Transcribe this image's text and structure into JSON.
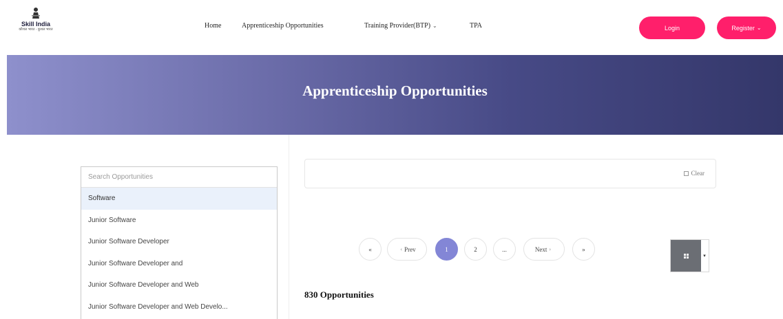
{
  "header": {
    "logo": {
      "text": "Skill India",
      "tagline": "कौशल भारत - कुशल भारत"
    },
    "nav": [
      {
        "label": "Home",
        "dropdown": false
      },
      {
        "label": "Apprenticeship Opportunities",
        "dropdown": false
      },
      {
        "label": "Training Provider(BTP)",
        "dropdown": true
      },
      {
        "label": "TPA",
        "dropdown": false
      }
    ],
    "login_label": "Login",
    "register_label": "Register",
    "accent_color": "#ff1f6b"
  },
  "banner": {
    "title": "Apprenticeship Opportunities"
  },
  "search": {
    "placeholder": "Search Opportunities",
    "suggestions": [
      "Software",
      "Junior Software",
      "Junior Software Developer",
      "Junior Software Developer and",
      "Junior Software Developer and Web",
      "Junior Software Developer and Web Develo..."
    ],
    "active_index": 0
  },
  "filters": {
    "clear_label": "Clear",
    "clear_icon": "square-icon"
  },
  "pagination": {
    "first": "«",
    "prev": "Prev",
    "pages": [
      "1",
      "2"
    ],
    "ellipsis": "...",
    "next": "Next",
    "last": "»",
    "current": "1",
    "active_color": "#8386d6"
  },
  "view_toggle": {
    "icon": "grid-icon",
    "dropdown_icon": "caret-down-icon"
  },
  "results": {
    "count_label": "830 Opportunities"
  }
}
